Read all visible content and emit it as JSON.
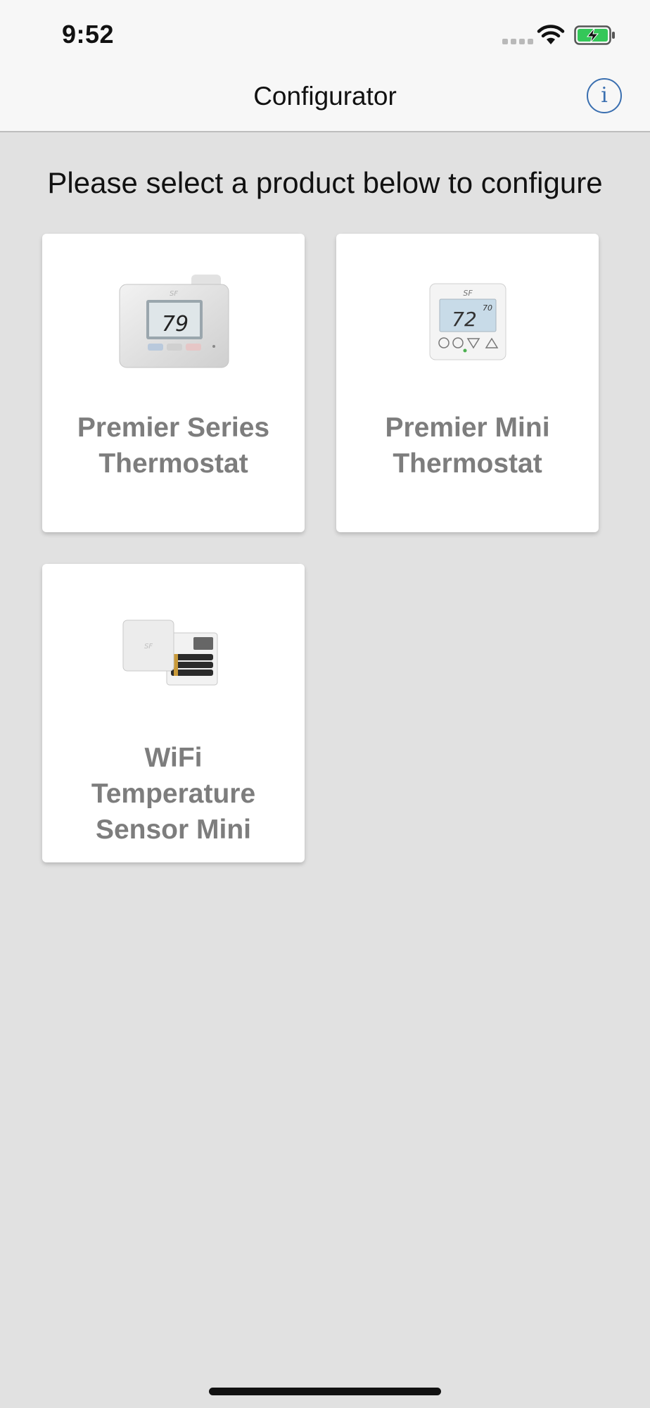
{
  "status_bar": {
    "time": "9:52",
    "icons": [
      "signal-icon",
      "wifi-icon",
      "battery-charging-icon"
    ],
    "battery_color": "#34c759"
  },
  "nav": {
    "title": "Configurator",
    "info_glyph": "i",
    "accent": "#3a6fb0"
  },
  "prompt": "Please select a product below to configure",
  "products": [
    {
      "lines": [
        "Premier Series",
        "Thermostat"
      ],
      "image_icon": "premier-series-thermostat-image",
      "display_reading": "79",
      "brand": "SF"
    },
    {
      "lines": [
        "Premier Mini",
        "Thermostat"
      ],
      "image_icon": "premier-mini-thermostat-image",
      "display_reading": "72",
      "setpoint": "70",
      "brand": "SF"
    },
    {
      "lines": [
        "WiFi",
        "Temperature",
        "Sensor Mini"
      ],
      "image_icon": "wifi-temperature-sensor-image",
      "brand": "SF"
    }
  ]
}
